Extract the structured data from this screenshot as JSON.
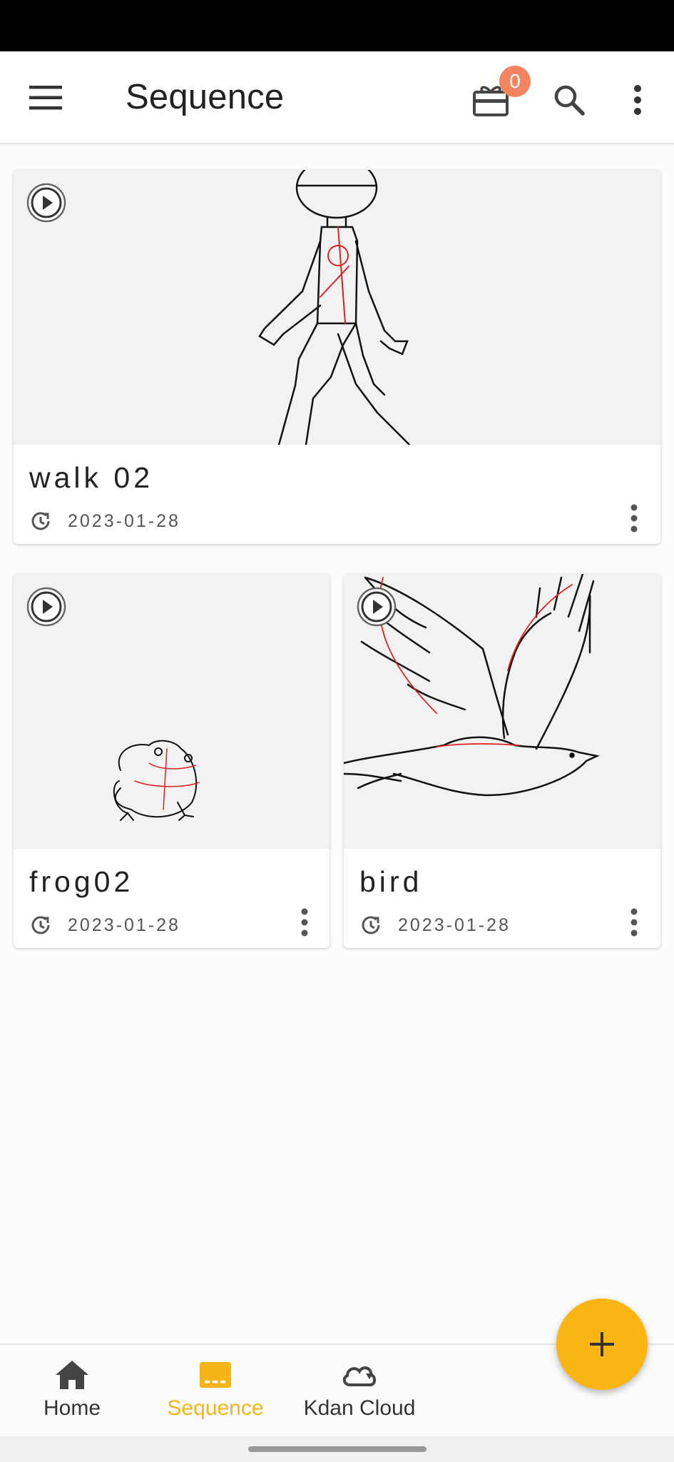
{
  "app_bar": {
    "title": "Sequence",
    "gift_badge_count": "0",
    "icons": [
      "menu-icon",
      "gift-icon",
      "search-icon",
      "more-vertical-icon"
    ]
  },
  "projects": [
    {
      "title": "walk 02",
      "date": "2023-01-28"
    },
    {
      "title": "frog02",
      "date": "2023-01-28"
    },
    {
      "title": "bird",
      "date": "2023-01-28"
    }
  ],
  "fab": {
    "icon": "plus-icon"
  },
  "bottom_nav": {
    "items": [
      {
        "label": "Home",
        "icon": "home-icon",
        "active": false
      },
      {
        "label": "Sequence",
        "icon": "sequence-icon",
        "active": true
      },
      {
        "label": "Kdan Cloud",
        "icon": "cloud-icon",
        "active": false
      }
    ]
  },
  "colors": {
    "accent": "#fbb614",
    "active_nav": "#f5b518",
    "badge": "#f4845f",
    "sketch_line": "#111111",
    "sketch_guide": "#e02020"
  }
}
